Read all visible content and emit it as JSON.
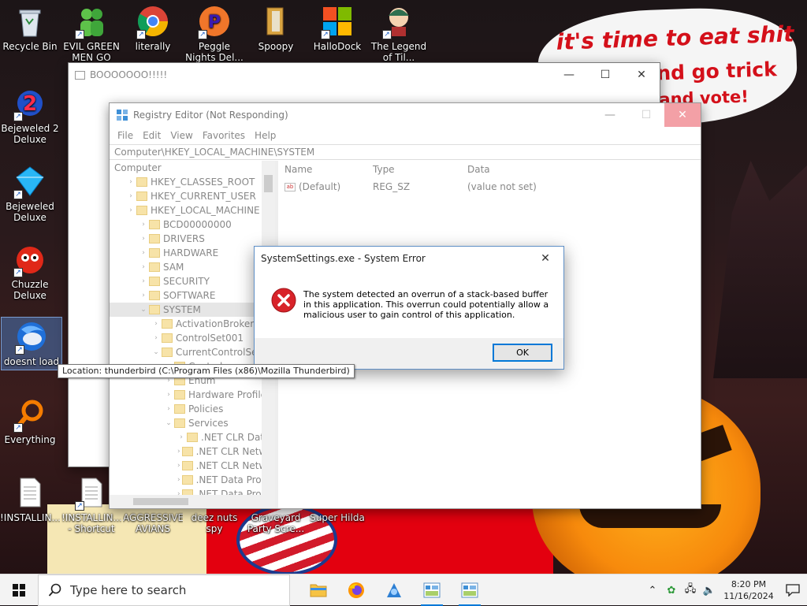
{
  "wallpaper": {
    "speech_line1": "it's time to eat shit",
    "speech_line2": "nd go trick",
    "speech_line3": "and vote!"
  },
  "desktop_icons": [
    {
      "label": "Recycle Bin",
      "icon": "recycle-bin-icon"
    },
    {
      "label": "EVIL GREEN MEN GO",
      "icon": "green-men-icon"
    },
    {
      "label": "literally",
      "icon": "chrome-icon"
    },
    {
      "label": "Peggle Nights Del...",
      "icon": "peggle-icon"
    },
    {
      "label": "Spoopy",
      "icon": "folder-icon"
    },
    {
      "label": "HalloDock",
      "icon": "windows-logo-icon"
    },
    {
      "label": "The Legend of Til...",
      "icon": "legend-character-icon"
    },
    {
      "label": "Bejeweled 2 Deluxe",
      "icon": "bejeweled2-icon"
    },
    {
      "label": "Bejeweled Deluxe",
      "icon": "bejeweled-gem-icon"
    },
    {
      "label": "Chuzzle Deluxe",
      "icon": "chuzzle-icon"
    },
    {
      "label": "doesnt load",
      "icon": "thunderbird-icon"
    },
    {
      "label": "Everything",
      "icon": "everything-search-icon"
    },
    {
      "label": "!INSTALLIN...",
      "icon": "text-file-icon"
    },
    {
      "label": "!INSTALLIN... - Shortcut",
      "icon": "text-file-icon"
    },
    {
      "label": "AGGRESSIVE AVIANS",
      "icon": "app-icon"
    },
    {
      "label": "deez nuts spy",
      "icon": "app-icon"
    },
    {
      "label": "Graveyard Party Scre...",
      "icon": "app-icon"
    },
    {
      "label": "Super Hilda",
      "icon": "app-icon"
    }
  ],
  "boo_window": {
    "title": "BOOOOOOO!!!!!",
    "min": "—",
    "max": "☐",
    "close": "✕"
  },
  "regedit": {
    "title": "Registry Editor (Not Responding)",
    "menu": [
      "File",
      "Edit",
      "View",
      "Favorites",
      "Help"
    ],
    "address": "Computer\\HKEY_LOCAL_MACHINE\\SYSTEM",
    "tree": [
      {
        "label": "Computer",
        "level": 0
      },
      {
        "label": "HKEY_CLASSES_ROOT",
        "level": 1
      },
      {
        "label": "HKEY_CURRENT_USER",
        "level": 1
      },
      {
        "label": "HKEY_LOCAL_MACHINE",
        "level": 1
      },
      {
        "label": "BCD00000000",
        "level": 2
      },
      {
        "label": "DRIVERS",
        "level": 2
      },
      {
        "label": "HARDWARE",
        "level": 2
      },
      {
        "label": "SAM",
        "level": 2
      },
      {
        "label": "SECURITY",
        "level": 2
      },
      {
        "label": "SOFTWARE",
        "level": 2
      },
      {
        "label": "SYSTEM",
        "level": 2,
        "selected": true
      },
      {
        "label": "ActivationBroker",
        "level": 3
      },
      {
        "label": "ControlSet001",
        "level": 3
      },
      {
        "label": "CurrentControlSet",
        "level": 3
      },
      {
        "label": "Control",
        "level": 4
      },
      {
        "label": "Enum",
        "level": 4
      },
      {
        "label": "Hardware Profiles",
        "level": 4
      },
      {
        "label": "Policies",
        "level": 4
      },
      {
        "label": "Services",
        "level": 4
      },
      {
        "label": ".NET CLR Data",
        "level": 5
      },
      {
        "label": ".NET CLR Networking",
        "level": 5
      },
      {
        "label": ".NET CLR Networking",
        "level": 5
      },
      {
        "label": ".NET Data Provider fo",
        "level": 5
      },
      {
        "label": ".NET Data Provider fo",
        "level": 5
      }
    ],
    "columns": [
      "Name",
      "Type",
      "Data"
    ],
    "rows": [
      {
        "name": "(Default)",
        "type": "REG_SZ",
        "data": "(value not set)"
      }
    ]
  },
  "error_dialog": {
    "title": "SystemSettings.exe - System Error",
    "message": "The system detected an overrun of a stack-based buffer in this application. This overrun could potentially allow a malicious user to gain control of this application.",
    "ok_label": "OK",
    "close": "✕"
  },
  "tooltip": "Location: thunderbird (C:\\Program Files (x86)\\Mozilla Thunderbird)",
  "taskbar": {
    "search_placeholder": "Type here to search",
    "apps": [
      "file-explorer-icon",
      "firefox-icon",
      "app-icon",
      "registry-editor-icon",
      "registry-editor-icon"
    ],
    "time": "8:20 PM",
    "date": "11/16/2024"
  }
}
